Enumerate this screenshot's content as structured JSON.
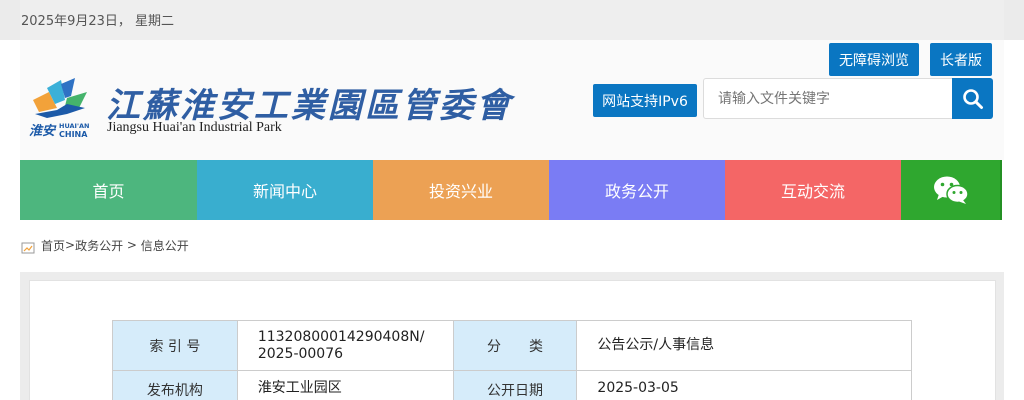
{
  "topbar": {
    "date": "2025年9月23日， 星期二"
  },
  "header": {
    "logo_title": "江蘇淮安工業園區管委會",
    "logo_subtitle": "Jiangsu  Huai'an Industrial Park",
    "logo_mark_text_1": "淮安",
    "logo_mark_text_2": "HUAI'AN",
    "logo_mark_text_3": "CHINA",
    "accessible_label": "无障碍浏览",
    "elder_label": "长者版",
    "ipv6_label": "网站支持IPv6",
    "search_placeholder": "请输入文件关键字"
  },
  "nav": {
    "items": [
      {
        "label": "首页"
      },
      {
        "label": "新闻中心"
      },
      {
        "label": "投资兴业"
      },
      {
        "label": "政务公开"
      },
      {
        "label": "互动交流"
      }
    ],
    "wechat_icon": "wechat-icon"
  },
  "breadcrumb": {
    "home": "首页",
    "sep1": ">",
    "level2": "政务公开",
    "sep2": " > ",
    "level3": "信息公开"
  },
  "meta": {
    "index_label": "索 引 号",
    "index_value": "11320800014290408N/2025-00076",
    "category_label": "分　　类",
    "category_value": "公告公示/人事信息",
    "publisher_label": "发布机构",
    "publisher_value": "淮安工业园区",
    "date_label": "公开日期",
    "date_value": "2025-03-05"
  },
  "colors": {
    "brand_blue": "#0a76c2",
    "nav_home": "#4db67e",
    "nav_news": "#39aecf",
    "nav_invest": "#eca154",
    "nav_gov": "#7a7cf4",
    "nav_interact": "#f46666",
    "nav_wechat": "#2fa72f"
  }
}
